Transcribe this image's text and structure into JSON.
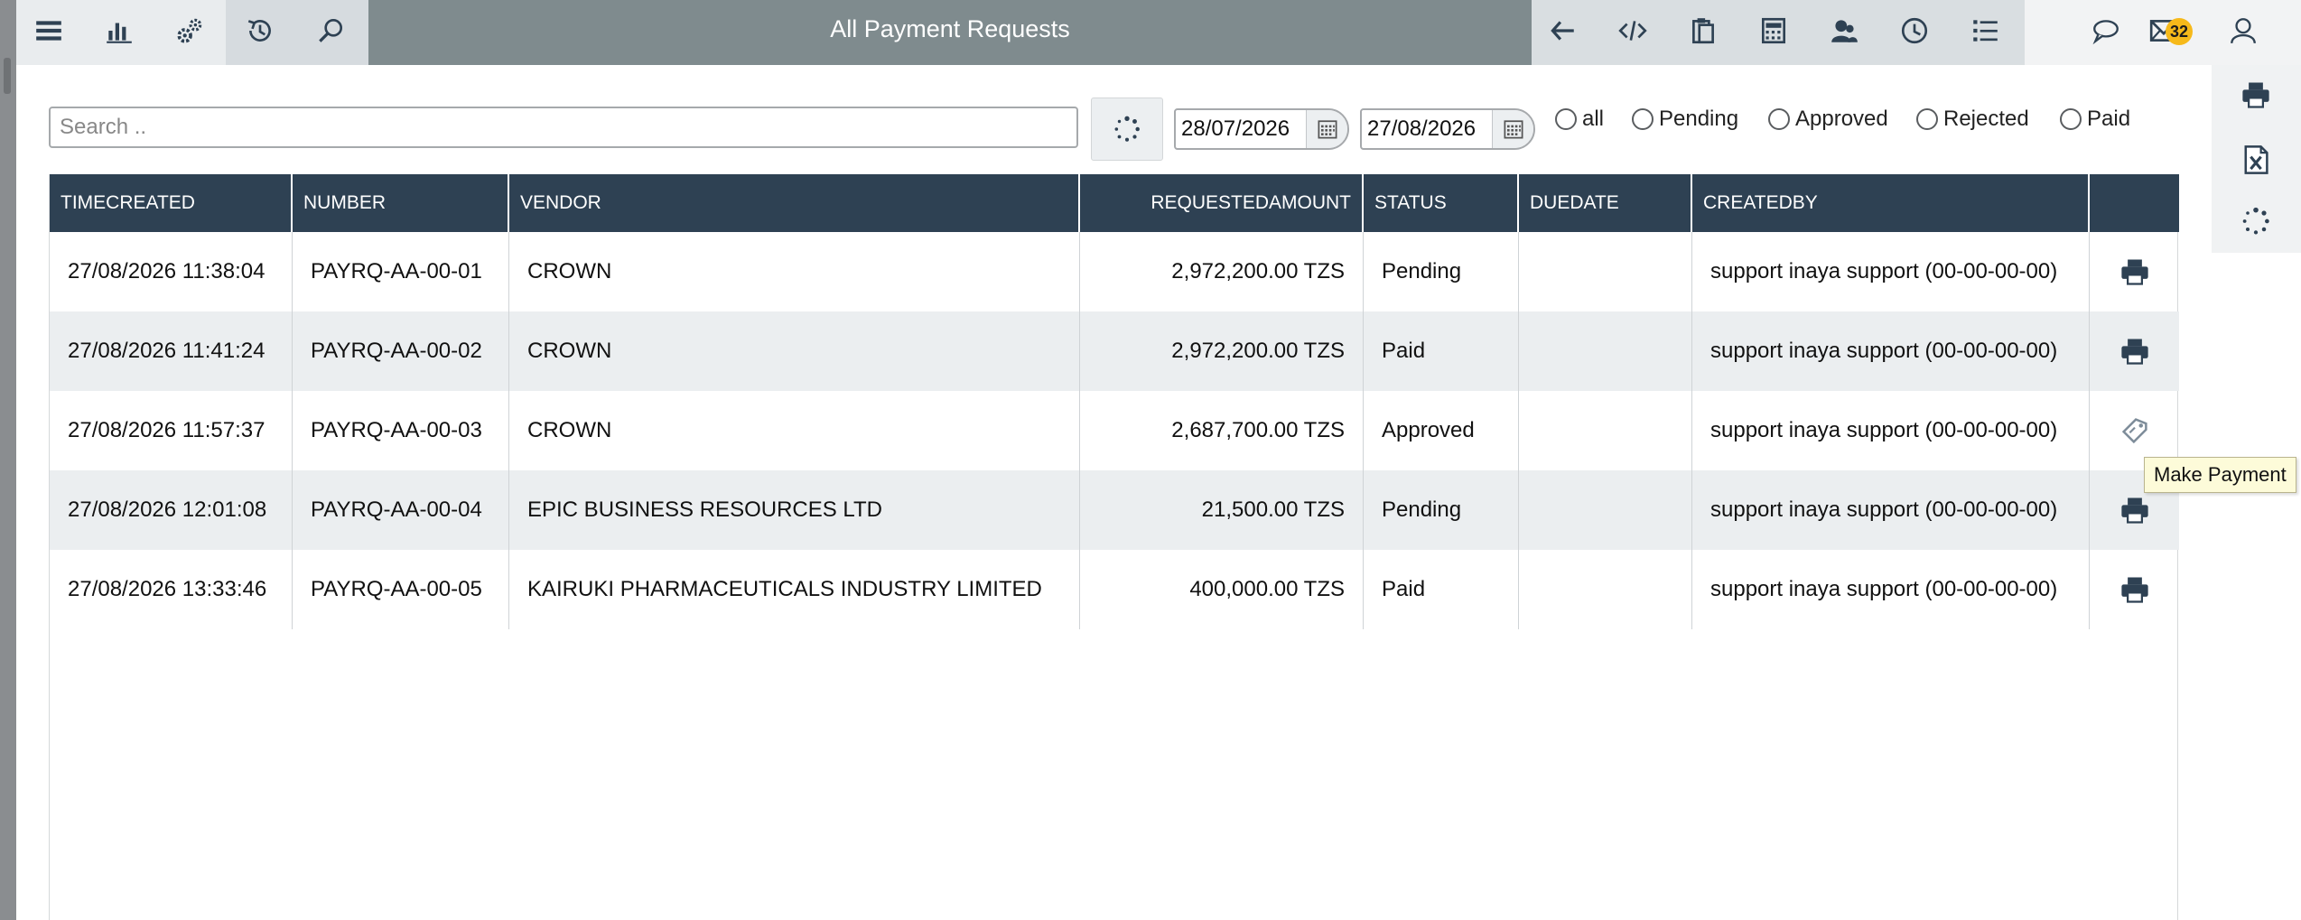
{
  "window": {
    "title": "All Payment Requests"
  },
  "toolbar": {
    "left_icons": [
      "menu-icon",
      "bar-chart-icon",
      "settings-gears-icon",
      "history-icon",
      "search-icon"
    ],
    "right_icons": [
      "back-arrow-icon",
      "code-icon",
      "clipboard-icon",
      "calculator-icon",
      "contacts-icon",
      "clock-icon",
      "list-icon"
    ],
    "far_icons": [
      "chat-icon",
      "mail-icon",
      "user-icon"
    ],
    "notification_count": "32",
    "badge_color": "#f6b91a",
    "title_bar_color": "#7f8b8e"
  },
  "side_tools": [
    "print-icon",
    "excel-export-icon",
    "loading-icon"
  ],
  "filters": {
    "search_placeholder": "Search ..",
    "date_from": "28/07/2026",
    "date_to": "27/08/2026",
    "status_options": [
      "all",
      "Pending",
      "Approved",
      "Rejected",
      "Paid"
    ]
  },
  "table": {
    "header_color": "#2e4153",
    "columns": [
      "TIMECREATED",
      "NUMBER",
      "VENDOR",
      "REQUESTEDAMOUNT",
      "STATUS",
      "DUEDATE",
      "CREATEDBY",
      ""
    ],
    "rows": [
      {
        "timecreated": "27/08/2026 11:38:04",
        "number": "PAYRQ-AA-00-01",
        "vendor": "CROWN",
        "amount": "2,972,200.00 TZS",
        "status": "Pending",
        "duedate": "",
        "createdby": "support inaya support (00-00-00-00)",
        "action_icon": "print-icon"
      },
      {
        "timecreated": "27/08/2026 11:41:24",
        "number": "PAYRQ-AA-00-02",
        "vendor": "CROWN",
        "amount": "2,972,200.00 TZS",
        "status": "Paid",
        "duedate": "",
        "createdby": "support inaya support (00-00-00-00)",
        "action_icon": "print-icon"
      },
      {
        "timecreated": "27/08/2026 11:57:37",
        "number": "PAYRQ-AA-00-03",
        "vendor": "CROWN",
        "amount": "2,687,700.00 TZS",
        "status": "Approved",
        "duedate": "",
        "createdby": "support inaya support (00-00-00-00)",
        "action_icon": "make-payment-icon"
      },
      {
        "timecreated": "27/08/2026 12:01:08",
        "number": "PAYRQ-AA-00-04",
        "vendor": "EPIC BUSINESS RESOURCES LTD",
        "amount": "21,500.00 TZS",
        "status": "Pending",
        "duedate": "",
        "createdby": "support inaya support (00-00-00-00)",
        "action_icon": "print-icon"
      },
      {
        "timecreated": "27/08/2026 13:33:46",
        "number": "PAYRQ-AA-00-05",
        "vendor": "KAIRUKI PHARMACEUTICALS INDUSTRY LIMITED",
        "amount": "400,000.00 TZS",
        "status": "Paid",
        "duedate": "",
        "createdby": "support inaya support (00-00-00-00)",
        "action_icon": "print-icon"
      }
    ]
  },
  "tooltip": {
    "text": "Make Payment"
  }
}
